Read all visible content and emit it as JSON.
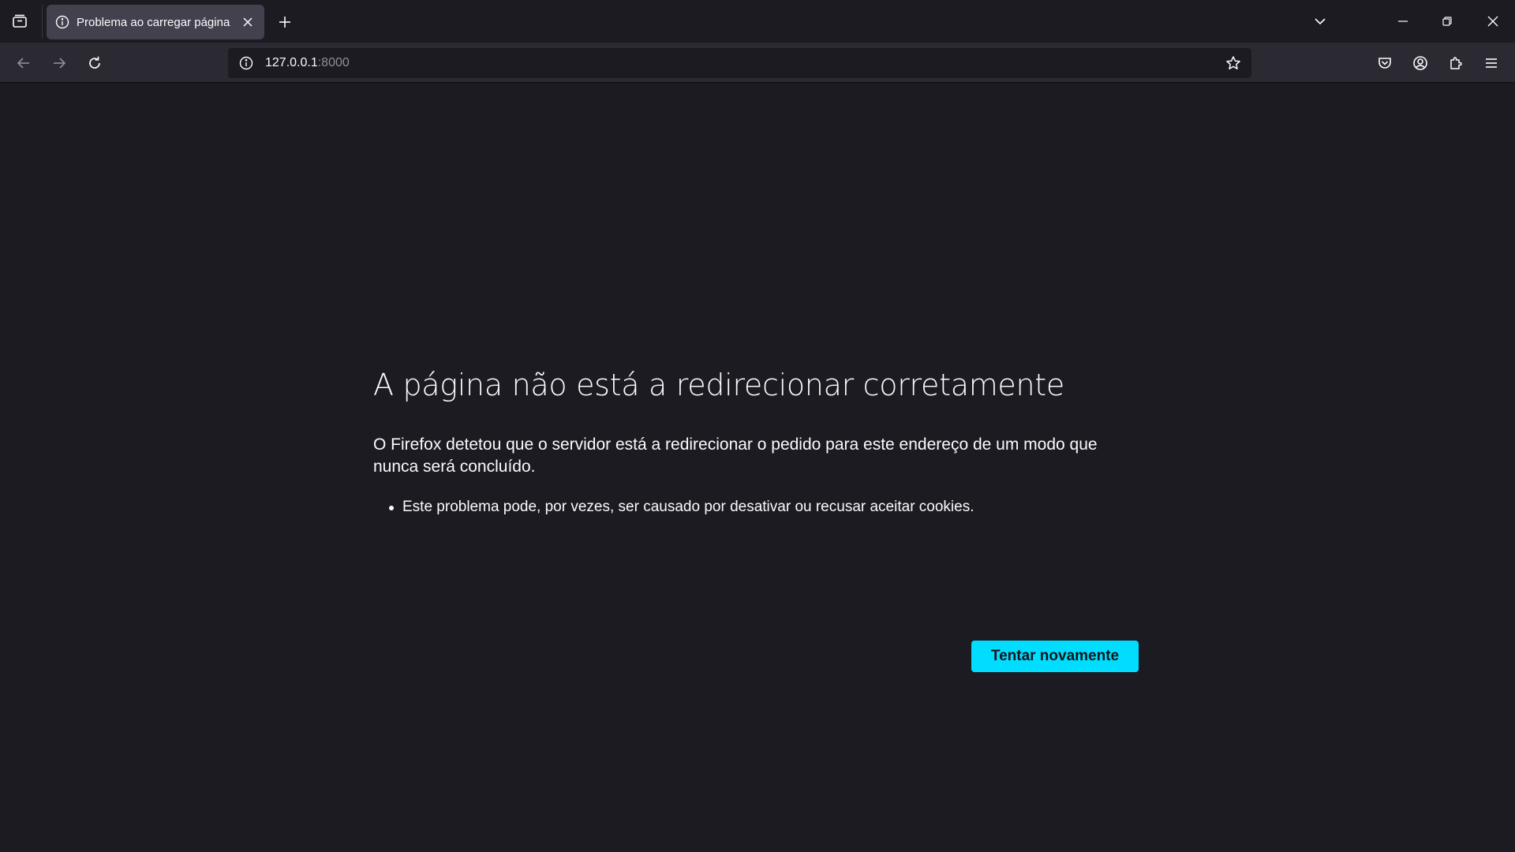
{
  "browser": {
    "tab": {
      "title": "Problema ao carregar página",
      "favicon": "info-icon"
    },
    "icons": {
      "tab_list": "tab-list-icon",
      "new_tab": "plus-icon",
      "tabs_dropdown": "chevron-down-icon",
      "minimize": "minimize-icon",
      "restore": "restore-icon",
      "close": "close-icon",
      "back": "arrow-left-icon",
      "forward": "arrow-right-icon",
      "reload": "reload-icon",
      "site_info": "info-icon",
      "bookmark": "star-icon",
      "pocket": "pocket-icon",
      "account": "account-icon",
      "extensions": "puzzle-icon",
      "menu": "hamburger-icon"
    },
    "url": {
      "host": "127.0.0.1",
      "port": ":8000"
    }
  },
  "error_page": {
    "title": "A página não está a redirecionar corretamente",
    "description": "O Firefox detetou que o servidor está a redirecionar o pedido para este endereço de um modo que nunca será concluído.",
    "hints": [
      "Este problema pode, por vezes, ser causado por desativar ou recusar aceitar cookies."
    ],
    "retry_label": "Tentar novamente"
  },
  "colors": {
    "background": "#1c1b22",
    "toolbar": "#2b2a33",
    "tab_selected": "#42414d",
    "accent_button": "#00ddff",
    "text": "#fbfbfe"
  }
}
